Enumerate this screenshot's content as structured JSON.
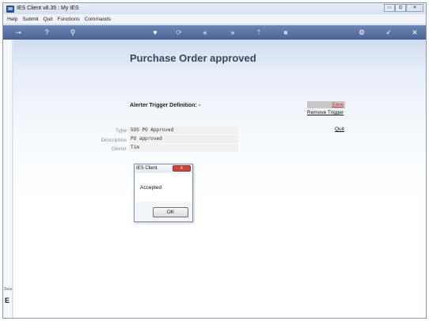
{
  "window": {
    "title": "IES Client v8.35 : My IES"
  },
  "window_controls": {
    "minimize": "▭",
    "maximize": "⊡",
    "close": "✕"
  },
  "menu": [
    "Help",
    "Submit",
    "Quit",
    "Functions",
    "Commands"
  ],
  "toolbar": {
    "icons": [
      "key-icon",
      "help-icon",
      "search-icon",
      "heart-icon",
      "refresh-icon",
      "back-double-icon",
      "forward-double-icon",
      "upload-icon",
      "stop-icon",
      "gear-icon",
      "check-icon",
      "close-icon"
    ],
    "glyphs": {
      "key": "⊸",
      "help": "?",
      "search": "⚲",
      "heart": "♥",
      "refresh": "⟳",
      "back": "«",
      "forward": "»",
      "upload": "⇡",
      "stop": "■",
      "gear": "⚙",
      "check": "✓",
      "close": "✕"
    }
  },
  "sidebar": {
    "label": "Sea",
    "glyph": "E"
  },
  "page": {
    "title": "Purchase Order approved",
    "definition_label": "Alerter Trigger Definition: -",
    "save": "Save",
    "remove_trigger": "Remove Trigger",
    "quit": "Quit",
    "fields": {
      "type": {
        "label": "Type",
        "value": "SOS PO Approved"
      },
      "description": {
        "label": "Description",
        "value": "PO approved"
      },
      "owner": {
        "label": "Owner",
        "value": "Tim"
      }
    }
  },
  "dialog": {
    "title": "IES Client",
    "message": "Accepted",
    "ok": "OK",
    "close": "x"
  },
  "colors": {
    "toolbar": "#5a73a6",
    "save_link": "#c0392b",
    "close_button": "#c9463d"
  }
}
